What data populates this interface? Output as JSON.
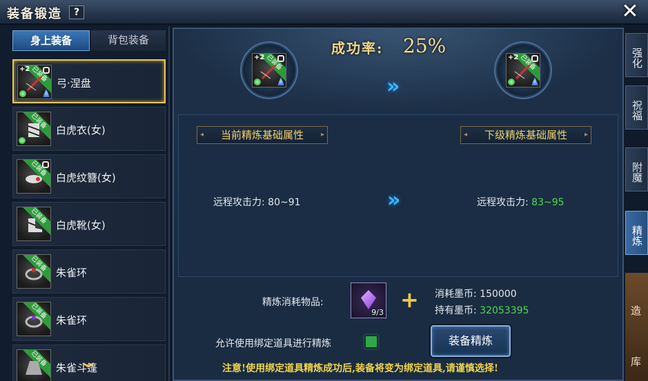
{
  "window": {
    "title": "装备锻造",
    "help_label": "?",
    "close_label": "✕"
  },
  "left_tabs": {
    "equipped_label": "身上装备",
    "bag_label": "背包装备"
  },
  "items": [
    {
      "name": "弓·涅盘",
      "badge": "已装备",
      "plus": "+2",
      "selected": true,
      "locked": true
    },
    {
      "name": "白虎衣(女)",
      "badge": "已装备",
      "plus": "",
      "selected": false,
      "locked": false
    },
    {
      "name": "白虎纹簪(女)",
      "badge": "已装备",
      "plus": "",
      "selected": false,
      "locked": true
    },
    {
      "name": "白虎靴(女)",
      "badge": "已装备",
      "plus": "",
      "selected": false,
      "locked": false
    },
    {
      "name": "朱雀环",
      "badge": "已装备",
      "plus": "",
      "selected": false,
      "locked": false
    },
    {
      "name": "朱雀环",
      "badge": "已装备",
      "plus": "",
      "selected": false,
      "locked": false
    },
    {
      "name": "朱雀斗篷",
      "badge": "已装备",
      "plus": "",
      "selected": false,
      "locked": false
    }
  ],
  "scroll_down_label": "⌄",
  "success": {
    "label": "成功率:",
    "value": "25%"
  },
  "current_slot": {
    "plus": "+2",
    "badge": "已装备"
  },
  "next_slot": {
    "plus": "+2",
    "badge": "已装备"
  },
  "attributes": {
    "current_header": "当前精炼基础属性",
    "next_header": "下级精炼基础属性",
    "current_label": "远程攻击力: ",
    "current_value": "80~91",
    "next_label": "远程攻击力: ",
    "next_value": "83~95"
  },
  "cost": {
    "label": "精炼消耗物品:",
    "item_count": "9/3",
    "plus_sign": "+",
    "consume_coin": "消耗墨币: 150000",
    "hold_label": "持有墨币: ",
    "hold_value": "32053395"
  },
  "allow_bound_label": "允许使用绑定道具进行精炼",
  "allow_bound_checked": true,
  "refine_button": "装备精炼",
  "notice": "注意!使用绑定道具精炼成功后,装备将变为绑定道具,请谨慎选择!",
  "side_tabs": [
    {
      "label": "强化",
      "active": false
    },
    {
      "label": "祝福",
      "active": false
    },
    {
      "label": "附魔",
      "active": false
    },
    {
      "label": "精炼",
      "active": true
    }
  ],
  "side_background_texts": [
    "造",
    "库"
  ],
  "colors": {
    "accent_gold": "#f0d68a",
    "positive_green": "#4ddc4d",
    "badge_green": "#2e9b3b",
    "tab_blue": "#3a77b8"
  }
}
